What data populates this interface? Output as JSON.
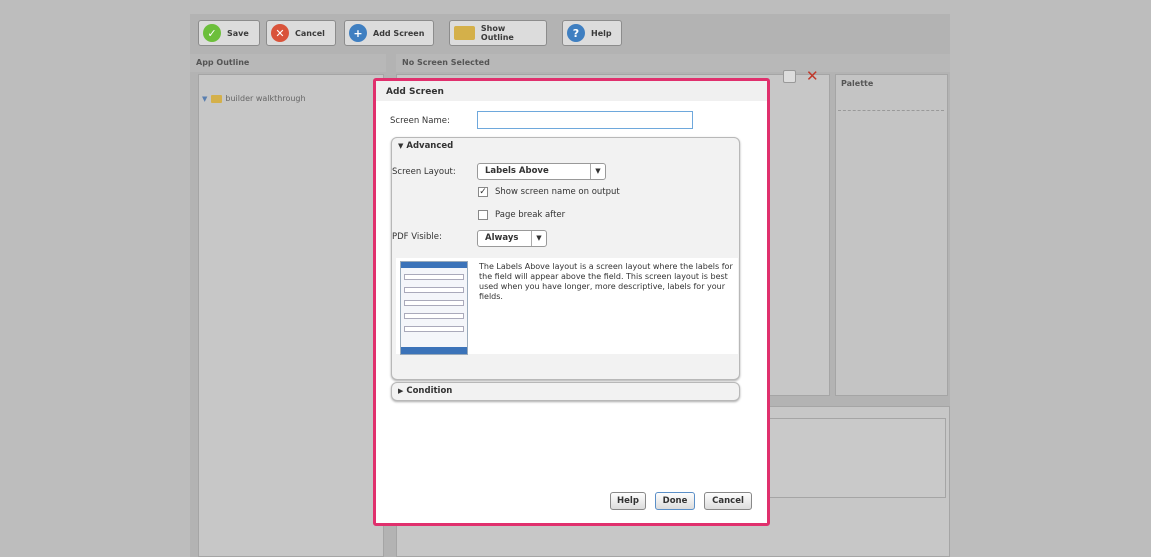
{
  "toolbar": {
    "save": "Save",
    "cancel": "Cancel",
    "add_screen": "Add Screen",
    "show_outline": "Show Outline",
    "help": "Help"
  },
  "panels": {
    "app_outline": "App Outline",
    "no_screen": "No Screen Selected",
    "palette": "Palette"
  },
  "tree": {
    "root": "builder walkthrough"
  },
  "dialog": {
    "title": "Add Screen",
    "screen_name_label": "Screen Name:",
    "screen_name_value": "",
    "advanced": {
      "header": "Advanced",
      "layout_label": "Screen Layout:",
      "layout_value": "Labels Above",
      "show_name_label": "Show screen name on output",
      "show_name_checked": true,
      "page_break_label": "Page break after",
      "page_break_checked": false,
      "pdf_label": "PDF Visible:",
      "pdf_value": "Always",
      "description": "The Labels Above layout is a screen layout where the labels for the field will appear above the field. This screen layout is best used when you have longer, more descriptive, labels for your fields."
    },
    "condition": "Condition",
    "buttons": {
      "help": "Help",
      "done": "Done",
      "cancel": "Cancel"
    }
  },
  "colors": {
    "accent": "#e0306d",
    "save": "#6cbf3b",
    "cancel": "#d9533a",
    "add": "#3f7fc1",
    "help": "#3f7fc1"
  }
}
